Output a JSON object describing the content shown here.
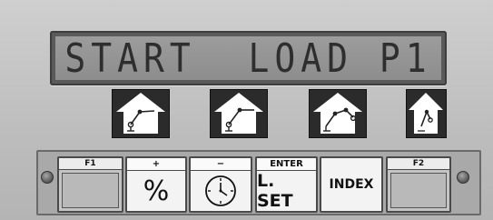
{
  "display": {
    "text": "START  LOAD P1"
  },
  "cursor_keys": [
    {
      "icon": "crane-home-icon"
    },
    {
      "icon": "crane-home-icon"
    },
    {
      "icon": "crane-home-icon"
    },
    {
      "icon": "crane-home-small-icon"
    }
  ],
  "keys": {
    "f1": {
      "top_label": "F1"
    },
    "plus": {
      "top_label": "+",
      "face": "%"
    },
    "minus": {
      "top_label": "−",
      "icon": "clock-icon"
    },
    "enter": {
      "top_label": "ENTER",
      "face": "L. SET"
    },
    "index": {
      "face": "INDEX"
    },
    "f2": {
      "top_label": "F2"
    }
  },
  "colors": {
    "panel": "#bdbdbd",
    "lcd": "#8f8f8f",
    "lcd_text": "#2e2e2e",
    "cursor_key": "#2b2b2b",
    "key_face": "#f3f3f3"
  }
}
